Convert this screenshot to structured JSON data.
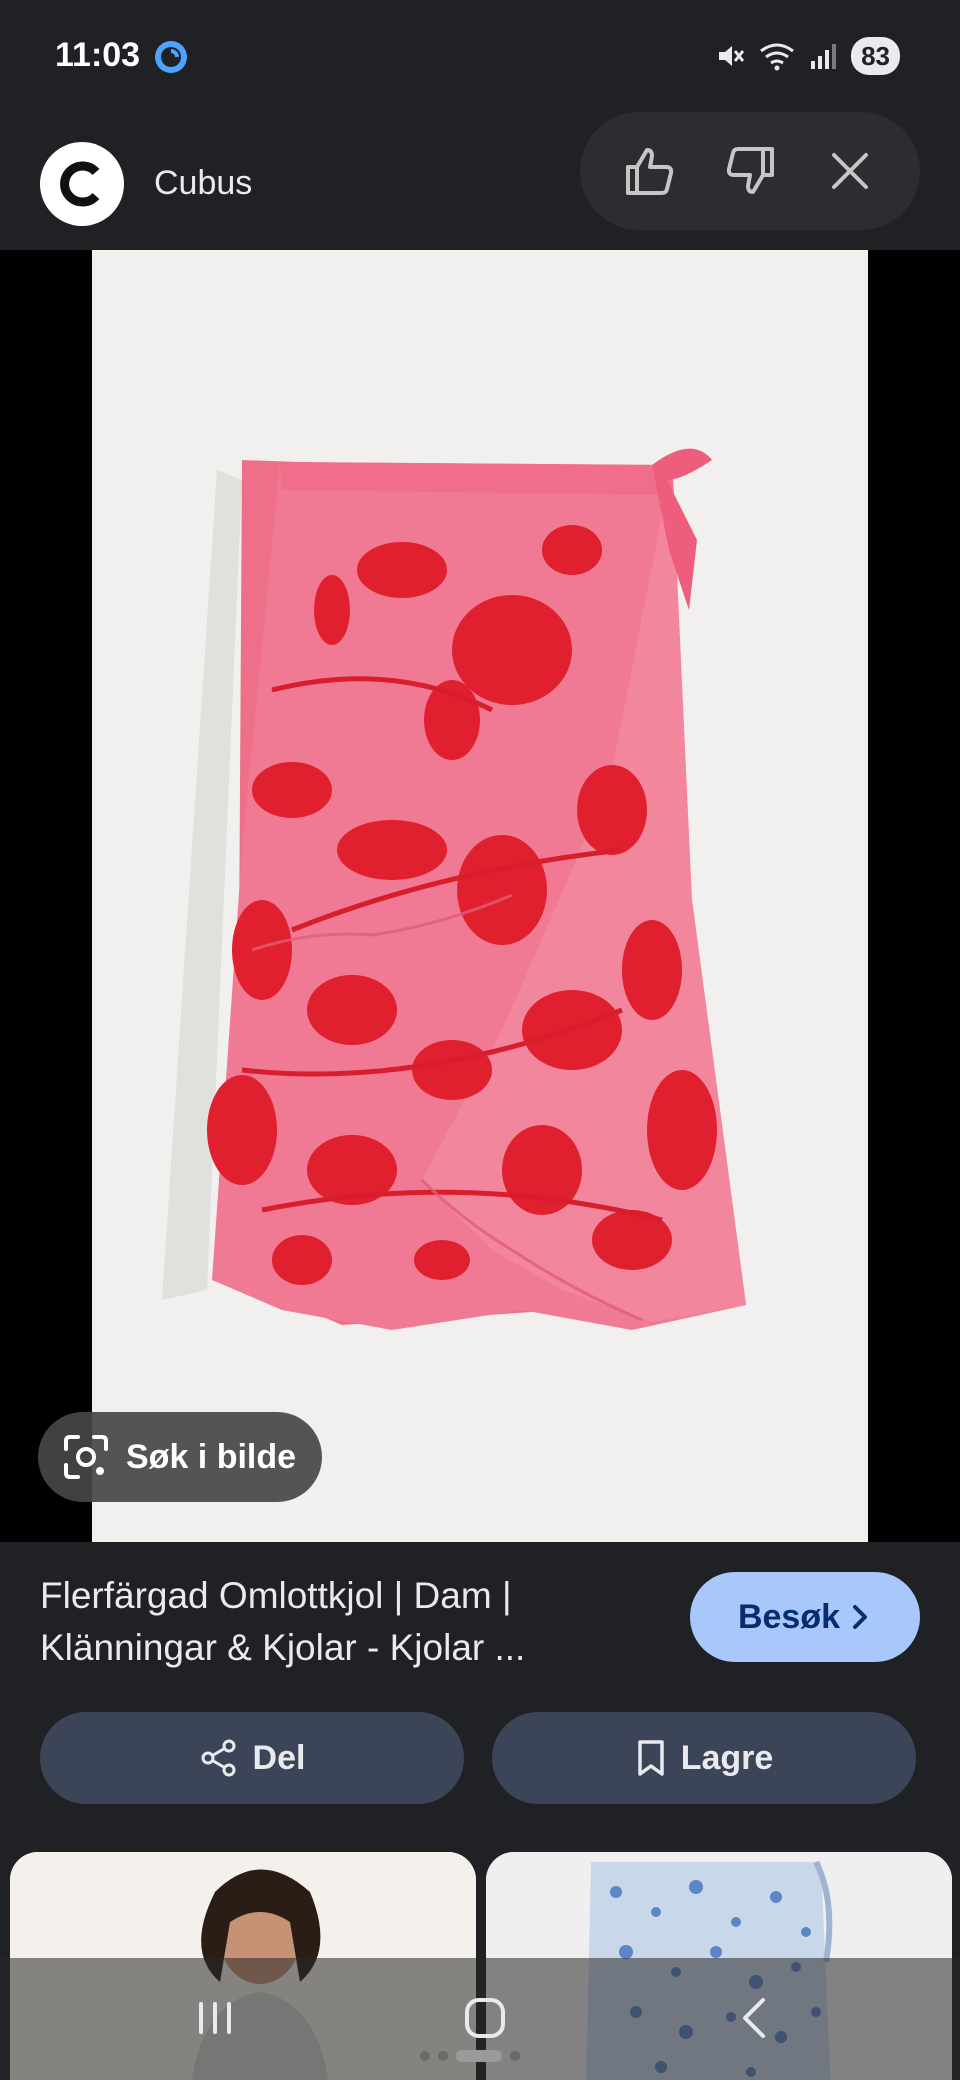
{
  "status_bar": {
    "time": "11:03",
    "battery": "83"
  },
  "header": {
    "site_name": "Cubus"
  },
  "image": {
    "lens_label": "Søk i bilde"
  },
  "result": {
    "title": "Flerfärgad Omlottkjol | Dam | Klänningar & Kjolar - Kjolar ...",
    "visit_label": "Besøk",
    "share_label": "Del",
    "save_label": "Lagre"
  },
  "colors": {
    "background": "#1f2125",
    "visit_button": "#a8c7fa",
    "action_button": "#3c4557",
    "skirt_pink": "#f0728d",
    "skirt_red": "#e0202e"
  }
}
